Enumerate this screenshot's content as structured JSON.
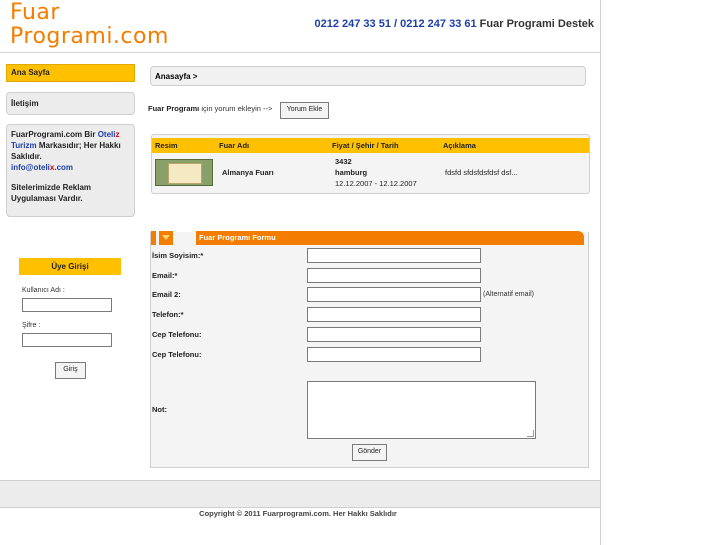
{
  "header": {
    "logo_line1": "Fuar",
    "logo_line2": "Programi.com",
    "phone1": "0212 247 33 51",
    "separator": "/",
    "phone2": "0212 247 33 61",
    "support_label": "Fuar Programi Destek"
  },
  "sidebar": {
    "home": "Ana Sayfa",
    "contact": "İletişim",
    "info": {
      "part1": "FuarProgrami.com Bir ",
      "brand_oteli": "Oteli",
      "brand_z": "z",
      "brand_turizm": "Turizm",
      "part2": " Markasıdır; Her Hakkı Saklıdır.",
      "email_prefix": "info@oteli",
      "email_x": "x",
      "email_suffix": ".com",
      "ads": "Sitelerimizde Reklam Uygulaması Vardır."
    },
    "login": {
      "title": "Üye Girişi",
      "username_label": "Kullanıcı Adı :",
      "password_label": "Şifre :",
      "submit": "Giriş"
    }
  },
  "breadcrumb": "Anasayfa >",
  "comment": {
    "bold": "Fuar Programı",
    "text": " için yorum ekleyin -->",
    "button": "Yorum Ekle"
  },
  "table": {
    "headers": [
      "Resim",
      "Fuar Adı",
      "Fiyat / Şehir / Tarih",
      "Açıklama"
    ],
    "row": {
      "name": "Almanya Fuarı",
      "price": "3432",
      "city": "hamburg",
      "dates": "12.12.2007 - 12.12.2007",
      "desc": "fdsfd sfdsfdsfdsf dsf..."
    }
  },
  "form": {
    "title": "Fuar Programı Formu",
    "fields": [
      "İsim Soyisim:*",
      "Email:*",
      "Email 2:",
      "Telefon:*",
      "Cep Telefonu:",
      "Cep Telefonu:",
      "Not:"
    ],
    "email2_note": "(Alternatif email)",
    "submit": "Gönder"
  },
  "footer": {
    "copyright": "Copyright © 2011 Fuarprogrami.com. Her Hakkı Saklıdır"
  },
  "colors": {
    "orange": "#f47d00",
    "yellow": "#ffc000",
    "blue": "#1c3ea8"
  }
}
